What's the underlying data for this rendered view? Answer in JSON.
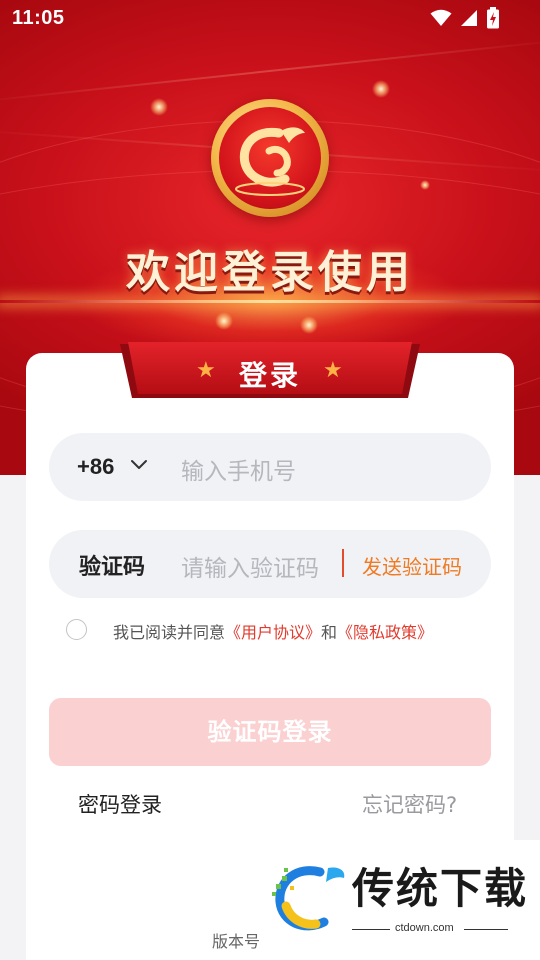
{
  "status_bar": {
    "time": "11:05"
  },
  "header": {
    "welcome": "欢迎登录使用"
  },
  "card": {
    "title": "登录"
  },
  "phone": {
    "country_code": "+86",
    "placeholder": "输入手机号"
  },
  "code": {
    "label": "验证码",
    "placeholder": "请输入验证码",
    "send_label": "发送验证码"
  },
  "agreement": {
    "prefix": "我已阅读并同意",
    "user_agreement": "《用户协议》",
    "joiner": "和",
    "privacy_policy": "《隐私政策》",
    "checked": false
  },
  "actions": {
    "login_button": "验证码登录",
    "password_login": "密码登录",
    "forgot_password": "忘记密码?"
  },
  "footer": {
    "version_label": "版本号"
  },
  "watermark": {
    "brand": "传统下载",
    "url": "ctdown.com"
  },
  "colors": {
    "brand_red": "#d2131b",
    "accent_orange": "#f07a22",
    "link_red": "#e23b2e",
    "disabled_button": "#fad0d1",
    "field_bg": "#f1f2f6"
  },
  "icons": [
    "wifi-icon",
    "signal-icon",
    "battery-charging-icon",
    "chevron-down-icon",
    "star-icon",
    "app-logo-icon"
  ]
}
